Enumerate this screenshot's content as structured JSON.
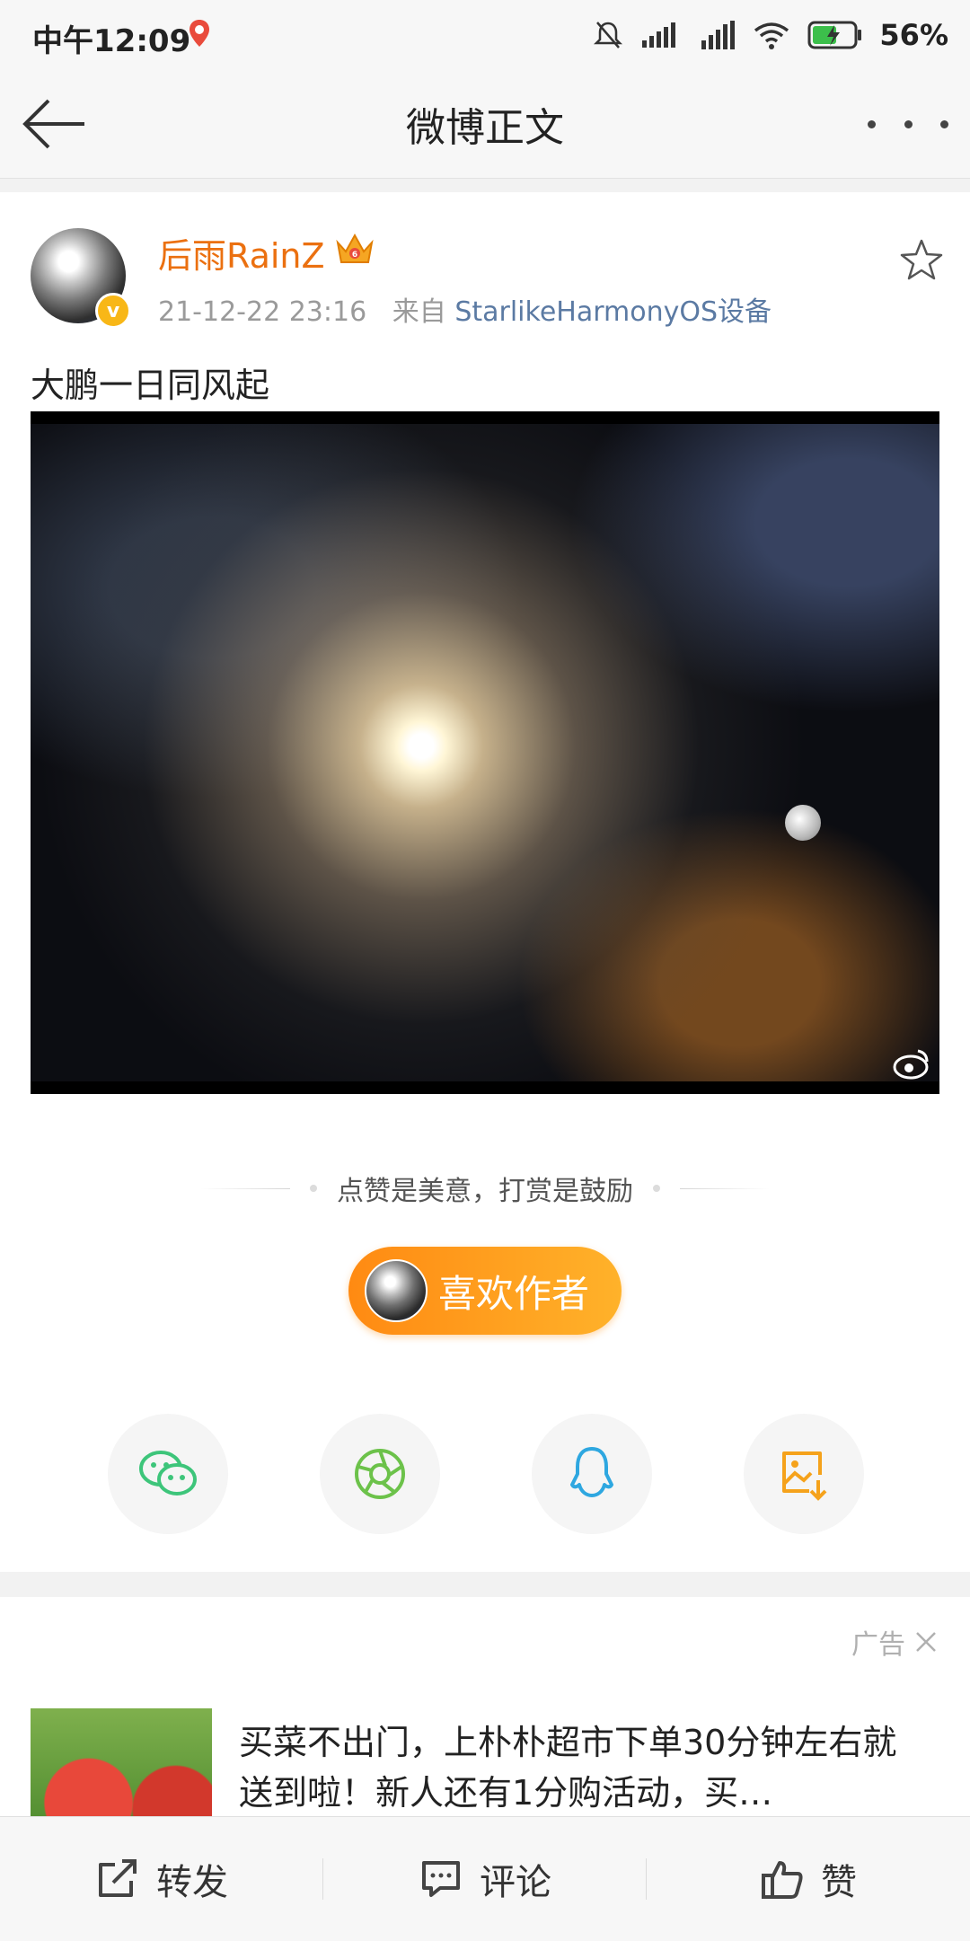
{
  "status_bar": {
    "time": "中午12:09",
    "battery": "56%"
  },
  "header": {
    "title": "微博正文"
  },
  "post": {
    "username": "后雨RainZ",
    "timestamp": "21-12-22 23:16",
    "source_prefix": "来自",
    "source": "StarlikeHarmonyOS设备",
    "text": "大鹏一日同风起",
    "reward_prompt": "点赞是美意，打赏是鼓励",
    "like_author_label": "喜欢作者",
    "share_targets": [
      "wechat-icon",
      "moments-icon",
      "qq-icon",
      "save-image-icon"
    ]
  },
  "ad": {
    "label": "广告",
    "text": "买菜不出门，上朴朴超市下单30分钟左右就送到啦！新人还有1分购活动，买…"
  },
  "bottom_bar": {
    "repost": "转发",
    "comment": "评论",
    "like": "赞"
  },
  "colors": {
    "username": "#eb7010",
    "source_link": "#5b7aa3",
    "accent_orange": "#ff8a12",
    "wechat_green": "#3dc57a",
    "qq_blue": "#2ea7e0",
    "save_orange": "#f5a21b"
  }
}
